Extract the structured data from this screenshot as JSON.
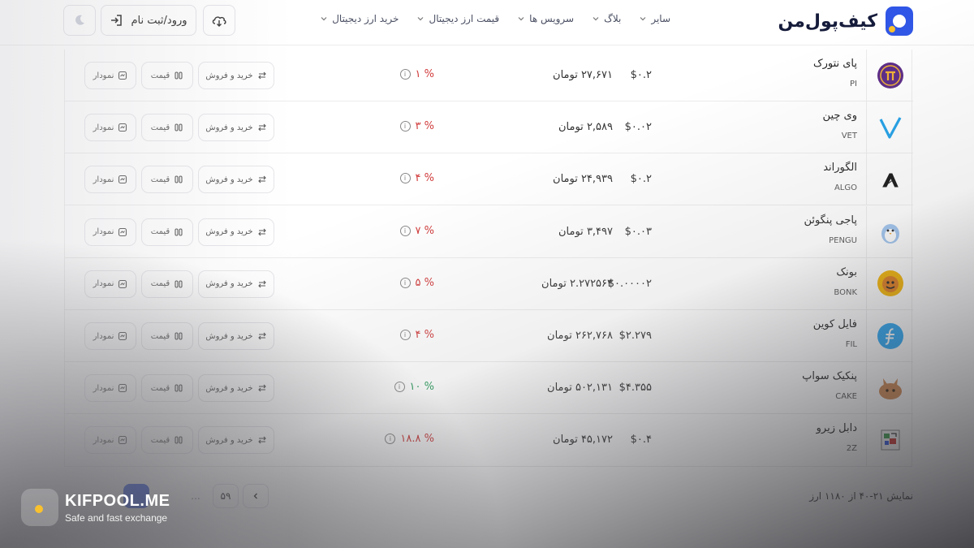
{
  "header": {
    "logo_text": "کیف‌پول‌من",
    "nav": [
      {
        "label": "خرید ارز دیجیتال"
      },
      {
        "label": "قیمت ارز دیجیتال"
      },
      {
        "label": "سرویس ها"
      },
      {
        "label": "بلاگ"
      },
      {
        "label": "سایر"
      }
    ],
    "login_label": "ورود/ثبت نام"
  },
  "table": {
    "rows": [
      {
        "name": "پای نتورک",
        "symbol": "PI",
        "usd": "$۰.۲",
        "toman": "۲۷,۶۷۱ تومان",
        "change": "۱ %",
        "trend": "down",
        "icon": "pi-icon"
      },
      {
        "name": "وی چین",
        "symbol": "VET",
        "usd": "$۰.۰۲",
        "toman": "۲,۵۸۹ تومان",
        "change": "۳ %",
        "trend": "down",
        "icon": "vechain-icon"
      },
      {
        "name": "الگوراند",
        "symbol": "ALGO",
        "usd": "$۰.۲",
        "toman": "۲۴,۹۳۹ تومان",
        "change": "۴ %",
        "trend": "down",
        "icon": "algorand-icon"
      },
      {
        "name": "پاجی پنگوئن",
        "symbol": "PENGU",
        "usd": "$۰.۰۳",
        "toman": "۳,۴۹۷ تومان",
        "change": "۷ %",
        "trend": "down",
        "icon": "pengu-icon"
      },
      {
        "name": "بونک",
        "symbol": "BONK",
        "usd": "$۰.۰۰۰۰۲",
        "toman": "۲.۲۷۲۵۶۳ تومان",
        "change": "۵ %",
        "trend": "down",
        "icon": "bonk-icon"
      },
      {
        "name": "فایل کوین",
        "symbol": "FIL",
        "usd": "$۲.۲۷۹",
        "toman": "۲۶۲,۷۶۸ تومان",
        "change": "۴ %",
        "trend": "down",
        "icon": "filecoin-icon"
      },
      {
        "name": "پنکیک سواپ",
        "symbol": "CAKE",
        "usd": "$۴.۳۵۵",
        "toman": "۵۰۲,۱۳۱ تومان",
        "change": "۱۰ %",
        "trend": "up",
        "icon": "pancakeswap-icon"
      },
      {
        "name": "دابل زیرو",
        "symbol": "2Z",
        "usd": "$۰.۴",
        "toman": "۴۵,۱۷۲ تومان",
        "change": "۱۸.۸ %",
        "trend": "down",
        "icon": "doublezero-icon"
      }
    ],
    "actions": {
      "trade": "خرید و فروش",
      "price": "قیمت",
      "chart": "نمودار"
    }
  },
  "pagination": {
    "info": "نمایش ۲۱-۴۰ از ۱۱۸۰ ارز",
    "last_page": "۵۹",
    "dots": "..."
  },
  "watermark": {
    "title": "KIFPOOL.ME",
    "subtitle": "Safe and fast exchange"
  },
  "colors": {
    "brand": "#2f56e6",
    "negative": "#d13b3b",
    "positive": "#2a9a5a"
  }
}
